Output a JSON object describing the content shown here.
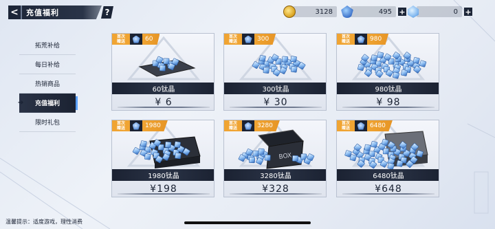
{
  "header": {
    "back_label": "<",
    "title": "充值福利",
    "help_label": "?"
  },
  "currencies": [
    {
      "icon": "gold-coin-icon",
      "value": "3128",
      "has_plus": false
    },
    {
      "icon": "gem-icon",
      "value": "495",
      "has_plus": true
    },
    {
      "icon": "crystal-icon",
      "value": "0",
      "has_plus": true
    }
  ],
  "sidebar": {
    "items": [
      {
        "label": "拓荒补给",
        "active": false
      },
      {
        "label": "每日补给",
        "active": false
      },
      {
        "label": "热销商品",
        "active": false
      },
      {
        "label": "充值福利",
        "active": true
      },
      {
        "label": "限时礼包",
        "active": false
      }
    ]
  },
  "badge_text": {
    "line1": "首次",
    "line2": "赠送"
  },
  "cards": [
    {
      "bonus": "60",
      "name": "60钛晶",
      "price": "¥ 6"
    },
    {
      "bonus": "300",
      "name": "300钛晶",
      "price": "¥ 30"
    },
    {
      "bonus": "980",
      "name": "980钛晶",
      "price": "¥ 98"
    },
    {
      "bonus": "1980",
      "name": "1980钛晶",
      "price": "¥198"
    },
    {
      "bonus": "3280",
      "name": "3280钛晶",
      "price": "¥328"
    },
    {
      "bonus": "6480",
      "name": "6480钛晶",
      "price": "¥648"
    }
  ],
  "box_label": "BOX",
  "footer": {
    "note": "温馨提示：适度游戏，理性消费"
  },
  "colors": {
    "accent": "#f0a432",
    "dark": "#1b2232",
    "crystal": "#4d86d8"
  }
}
